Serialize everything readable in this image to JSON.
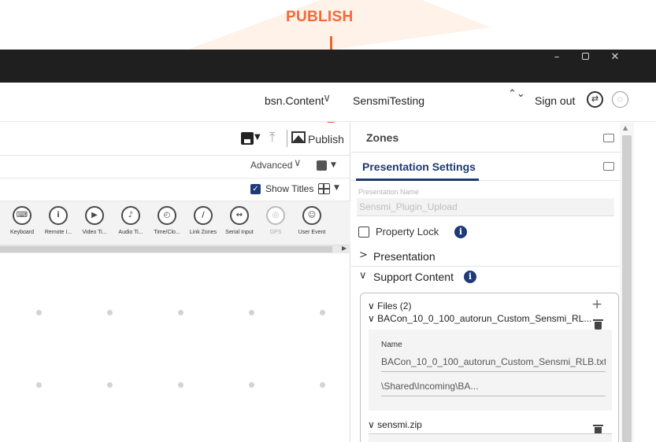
{
  "annotation": {
    "label": "PUBLISH"
  },
  "window": {
    "minimize": "–",
    "close": "✕"
  },
  "topbar": {
    "product": "bsn.Content",
    "product_chevron": "∨",
    "account": "SensmiTesting",
    "account_switch": "⌃⌄",
    "sign_out": "Sign out",
    "sync_glyph": "⇄",
    "globe_glyph": "◌"
  },
  "editor_toolbar": {
    "upload_glyph": "⤒",
    "publish_label": "Publish",
    "advanced_label": "Advanced",
    "advanced_chevron": "∨",
    "dropdown_glyph": "▼",
    "show_titles_label": "Show Titles",
    "show_titles_checked": true
  },
  "widgets": [
    {
      "label": "Keyboard",
      "icon": "keyboard-icon",
      "glyph": "⌨",
      "enabled": true
    },
    {
      "label": "Remote I...",
      "icon": "remote-icon",
      "glyph": "i",
      "enabled": true
    },
    {
      "label": "Video Ti...",
      "icon": "video-time-icon",
      "glyph": "▶",
      "enabled": true
    },
    {
      "label": "Audio Ti...",
      "icon": "audio-time-icon",
      "glyph": "♪",
      "enabled": true
    },
    {
      "label": "Time/Clo...",
      "icon": "time-clock-icon",
      "glyph": "◴",
      "enabled": true
    },
    {
      "label": "Link Zones",
      "icon": "link-zones-icon",
      "glyph": "∕",
      "enabled": true
    },
    {
      "label": "Serial Input",
      "icon": "serial-input-icon",
      "glyph": "↔",
      "enabled": true
    },
    {
      "label": "GPS",
      "icon": "gps-icon",
      "glyph": "◎",
      "enabled": false
    },
    {
      "label": "User Event",
      "icon": "user-event-icon",
      "glyph": "☺",
      "enabled": true
    }
  ],
  "right_panel": {
    "zones_label": "Zones",
    "presentation_settings_label": "Presentation Settings",
    "presentation_name_label": "Presentation Name",
    "presentation_name_value": "Sensmi_Plugin_Upload",
    "property_lock_label": "Property Lock",
    "info_glyph": "i",
    "presentation_section": {
      "label": "Presentation",
      "chevron": ">"
    },
    "support_content_section": {
      "label": "Support Content",
      "chevron": "∨"
    },
    "files": {
      "title": "Files (2)",
      "title_chevron": "∨",
      "add_glyph": "+",
      "items": [
        {
          "row_label": "BACon_10_0_100_autorun_Custom_Sensmi_RL...",
          "chevron": "∨",
          "detail_name_label": "Name",
          "detail_name_value": "BACon_10_0_100_autorun_Custom_Sensmi_RLB.txt",
          "detail_path_value": "\\Shared\\Incoming\\BA..."
        },
        {
          "row_label": "sensmi.zip",
          "chevron": "∨"
        }
      ]
    }
  },
  "colors": {
    "accent_orange": "#e9642f",
    "brand_navy": "#1e3a6e",
    "titlebar": "#1f1f1f"
  }
}
